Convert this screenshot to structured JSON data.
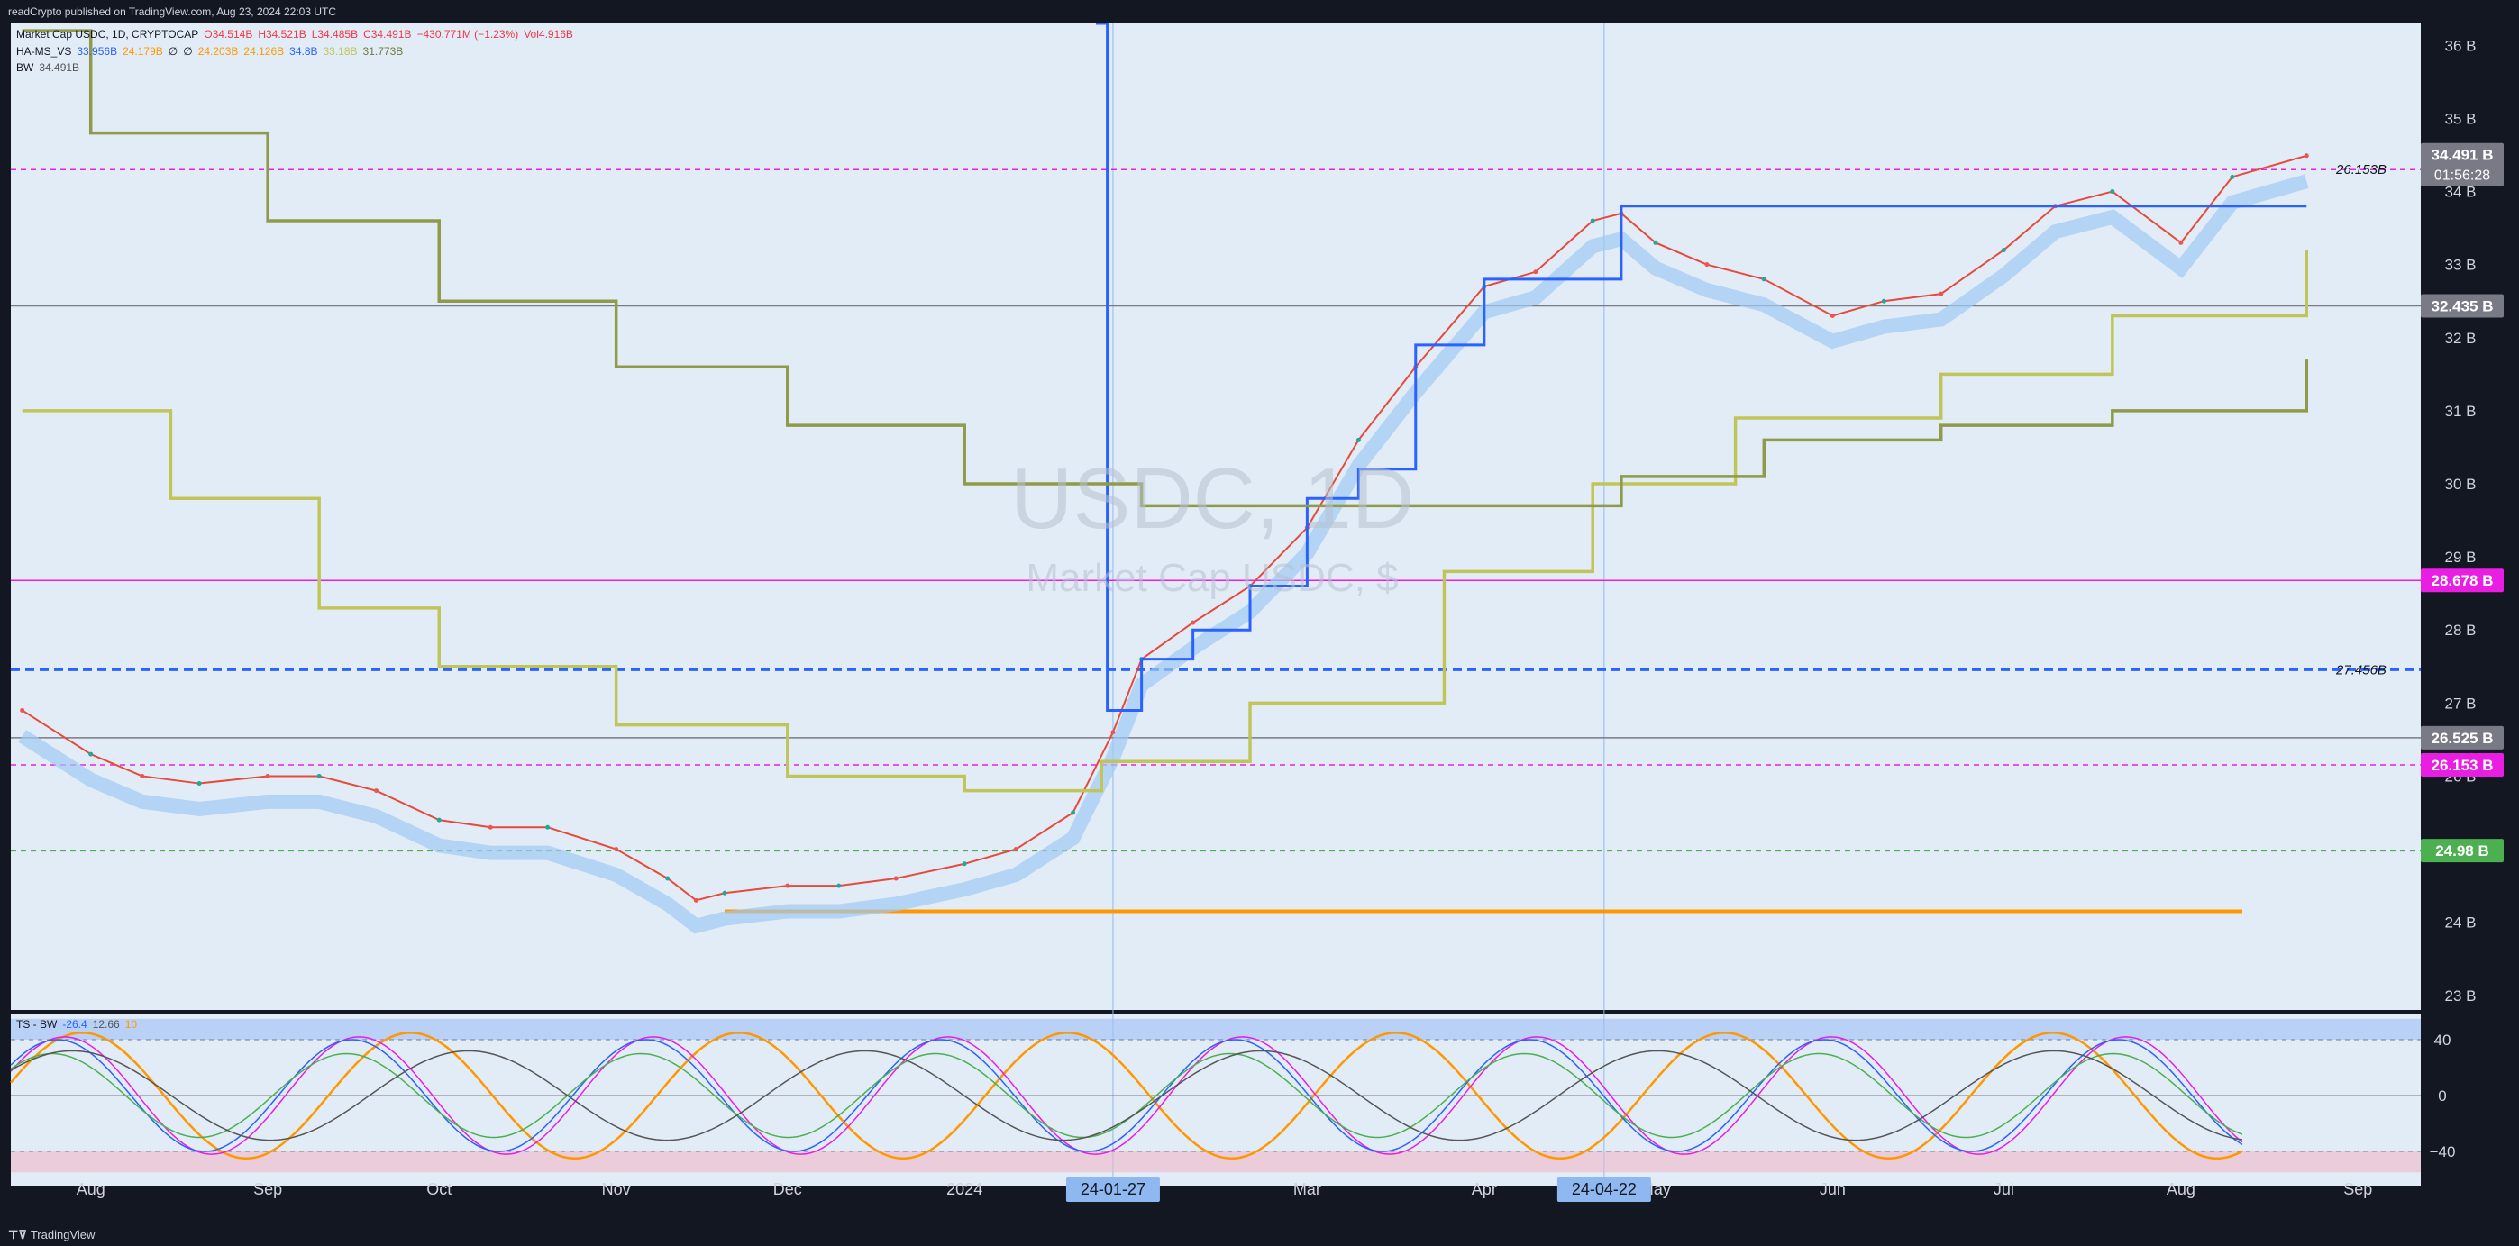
{
  "header": {
    "published": "readCrypto published on TradingView.com, Aug 23, 2024 22:03 UTC"
  },
  "footer": {
    "brand": "TradingView"
  },
  "legend": {
    "main": [
      {
        "text": "Market Cap USDC, 1D, CRYPTOCAP",
        "color": "#131722"
      },
      {
        "text": "O34.514B",
        "color": "#f23645"
      },
      {
        "text": "H34.521B",
        "color": "#f23645"
      },
      {
        "text": "L34.485B",
        "color": "#f23645"
      },
      {
        "text": "C34.491B",
        "color": "#f23645"
      },
      {
        "text": "−430.771M (−1.23%)",
        "color": "#f23645"
      },
      {
        "text": "Vol4.916B",
        "color": "#f23645"
      }
    ],
    "ha": [
      {
        "text": "HA-MS_VS",
        "color": "#131722"
      },
      {
        "text": "33.956B",
        "color": "#2962ff"
      },
      {
        "text": "24.179B",
        "color": "#ff9800"
      },
      {
        "text": "∅",
        "color": "#131722"
      },
      {
        "text": "∅",
        "color": "#131722"
      },
      {
        "text": "24.203B",
        "color": "#ff9800"
      },
      {
        "text": "24.126B",
        "color": "#ff9800"
      },
      {
        "text": "34.8B",
        "color": "#2962ff"
      },
      {
        "text": "33.18B",
        "color": "#c0c55a"
      },
      {
        "text": "31.773B",
        "color": "#6e7a3a"
      }
    ],
    "bw": [
      {
        "text": "BW",
        "color": "#131722"
      },
      {
        "text": "34.491B",
        "color": "#555"
      }
    ],
    "osc": [
      {
        "text": "TS - BW",
        "color": "#131722"
      },
      {
        "text": "-26.4",
        "color": "#2962ff"
      },
      {
        "text": "12.66",
        "color": "#555"
      },
      {
        "text": "10",
        "color": "#ff9800"
      }
    ]
  },
  "watermark": {
    "symbol": "USDC, 1D",
    "name": "Market Cap USDC, $"
  },
  "price_scale": {
    "ticks": [
      "23 B",
      "24 B",
      "25 B",
      "26 B",
      "27 B",
      "28 B",
      "29 B",
      "30 B",
      "31 B",
      "32 B",
      "33 B",
      "34 B",
      "35 B",
      "36 B"
    ],
    "labels": [
      {
        "text": "34.491 B",
        "sub": "01:56:28",
        "bg": "#787b86",
        "fg": "#ffffff",
        "value": 34.491
      },
      {
        "text": "32.435 B",
        "bg": "#787b86",
        "fg": "#ffffff",
        "value": 32.435
      },
      {
        "text": "28.678 B",
        "bg": "#e91ee3",
        "fg": "#ffffff",
        "value": 28.678
      },
      {
        "text": "26.525 B",
        "bg": "#787b86",
        "fg": "#ffffff",
        "value": 26.525
      },
      {
        "text": "26.153 B",
        "bg": "#e91ee3",
        "fg": "#ffffff",
        "value": 26.153
      },
      {
        "text": "24.98 B",
        "bg": "#4caf50",
        "fg": "#ffffff",
        "value": 24.98
      }
    ],
    "level_annotations": [
      {
        "text": "26.153B",
        "value": 34.3
      },
      {
        "text": "27.456B",
        "value": 27.456
      }
    ]
  },
  "osc_scale": {
    "ticks": [
      "40",
      "0",
      "−40"
    ]
  },
  "time_scale": {
    "ticks": [
      "Aug",
      "Sep",
      "Oct",
      "Nov",
      "Dec",
      "2024",
      "Mar",
      "Apr",
      "May",
      "Jun",
      "Jul",
      "Aug",
      "Sep"
    ],
    "highlights": [
      "24-01-27",
      "24-04-22"
    ]
  },
  "colors": {
    "chart_bg": "#e2ecf7",
    "magenta": "#e91ee3",
    "blue": "#2962ff",
    "orange": "#ff9800",
    "olive_light": "#c0c55a",
    "olive_dark": "#8f9a4a",
    "green": "#4caf50"
  },
  "chart_data": {
    "type": "line",
    "title": "Market Cap USDC, 1D, CRYPTOCAP",
    "ylim": [
      22.8,
      36.3
    ],
    "series": [
      {
        "name": "Market Cap USDC",
        "x": [
          "2023-07-20",
          "2023-08-01",
          "2023-08-10",
          "2023-08-20",
          "2023-09-01",
          "2023-09-10",
          "2023-09-20",
          "2023-10-01",
          "2023-10-10",
          "2023-10-20",
          "2023-11-01",
          "2023-11-10",
          "2023-11-15",
          "2023-11-20",
          "2023-12-01",
          "2023-12-10",
          "2023-12-20",
          "2024-01-01",
          "2024-01-10",
          "2024-01-20",
          "2024-01-27",
          "2024-02-01",
          "2024-02-10",
          "2024-02-20",
          "2024-03-01",
          "2024-03-10",
          "2024-03-20",
          "2024-04-01",
          "2024-04-10",
          "2024-04-20",
          "2024-04-25",
          "2024-05-01",
          "2024-05-10",
          "2024-05-20",
          "2024-06-01",
          "2024-06-10",
          "2024-06-20",
          "2024-07-01",
          "2024-07-10",
          "2024-07-20",
          "2024-08-01",
          "2024-08-10",
          "2024-08-23"
        ],
        "values": [
          26.9,
          26.3,
          26.0,
          25.9,
          26.0,
          26.0,
          25.8,
          25.4,
          25.3,
          25.3,
          25.0,
          24.6,
          24.3,
          24.4,
          24.5,
          24.5,
          24.6,
          24.8,
          25.0,
          25.5,
          26.6,
          27.6,
          28.1,
          28.6,
          29.4,
          30.6,
          31.6,
          32.7,
          32.9,
          33.6,
          33.7,
          33.3,
          33.0,
          32.8,
          32.3,
          32.5,
          32.6,
          33.2,
          33.8,
          34.0,
          33.3,
          34.2,
          34.49
        ]
      },
      {
        "name": "Upper step level",
        "x": [
          "2024-01-24",
          "2024-01-26",
          "2024-02-01",
          "2024-02-10",
          "2024-02-20",
          "2024-03-01",
          "2024-03-10",
          "2024-03-20",
          "2024-04-01",
          "2024-04-25",
          "2024-08-23"
        ],
        "values": [
          36.3,
          26.9,
          27.6,
          28.0,
          28.6,
          29.8,
          30.2,
          31.9,
          32.8,
          33.8,
          33.8
        ]
      },
      {
        "name": "Lower trailing level",
        "x": [
          "2023-07-20",
          "2023-08-15",
          "2023-09-10",
          "2023-10-01",
          "2023-11-01",
          "2023-12-01",
          "2024-01-01",
          "2024-01-25",
          "2024-02-20",
          "2024-03-25",
          "2024-04-20",
          "2024-05-15",
          "2024-06-20",
          "2024-07-20",
          "2024-08-23"
        ],
        "values": [
          31.0,
          29.8,
          28.3,
          27.5,
          26.7,
          26.0,
          25.8,
          26.2,
          27.0,
          28.8,
          30.0,
          30.9,
          31.5,
          32.3,
          33.2
        ]
      },
      {
        "name": "Upper trailing level",
        "x": [
          "2023-07-20",
          "2023-08-01",
          "2023-09-01",
          "2023-10-01",
          "2023-11-01",
          "2023-12-01",
          "2024-01-01",
          "2024-02-01",
          "2024-03-15",
          "2024-04-25",
          "2024-05-20",
          "2024-06-20",
          "2024-07-20",
          "2024-08-20",
          "2024-08-23"
        ],
        "values": [
          36.2,
          34.8,
          33.6,
          32.5,
          31.6,
          30.8,
          30.0,
          29.7,
          29.7,
          30.1,
          30.6,
          30.8,
          31.0,
          31.0,
          31.7
        ]
      }
    ],
    "hlines": [
      {
        "value": 34.3,
        "style": "dashed",
        "color": "#e91ee3"
      },
      {
        "value": 32.435,
        "style": "solid",
        "color": "#787b86"
      },
      {
        "value": 28.678,
        "style": "solid",
        "color": "#e91ee3"
      },
      {
        "value": 27.456,
        "style": "dashed",
        "color": "#2962ff"
      },
      {
        "value": 26.525,
        "style": "solid",
        "color": "#787b86"
      },
      {
        "value": 26.153,
        "style": "dashed",
        "color": "#e91ee3"
      },
      {
        "value": 24.98,
        "style": "dashed",
        "color": "#4caf50"
      },
      {
        "value": 24.15,
        "style": "solid",
        "color": "#ff9800"
      }
    ],
    "oscillator": {
      "ylim": [
        -55,
        55
      ],
      "levels": [
        40,
        0,
        -40
      ]
    }
  }
}
